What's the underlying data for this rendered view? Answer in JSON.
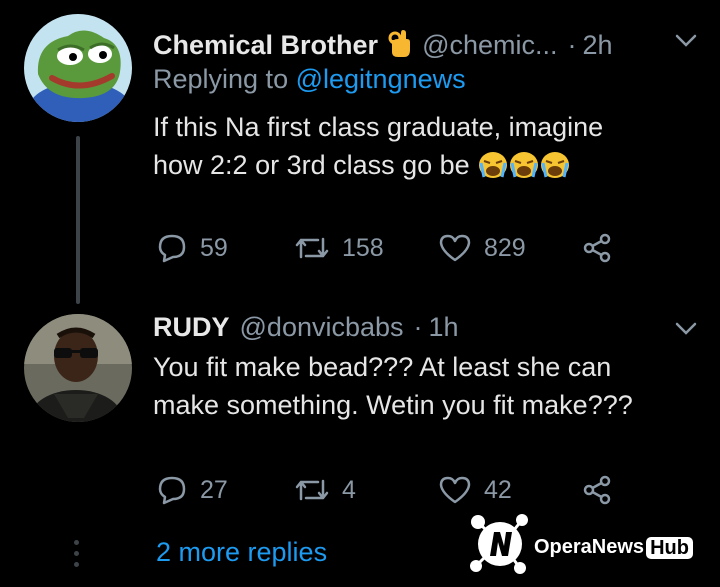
{
  "tweets": [
    {
      "name": "Chemical Brother",
      "name_emoji": "👌",
      "handle": "@chemic...",
      "dot": "·",
      "time": "2h",
      "replying_prefix": "Replying to",
      "replying_to": "@legitngnews",
      "body_lines": [
        "If this Na first class graduate, imagine",
        "how 2:2 or 3rd class go be"
      ],
      "replies": "59",
      "retweets": "158",
      "likes": "829"
    },
    {
      "name": "RUDY",
      "handle": "@donvicbabs",
      "dot": "·",
      "time": "1h",
      "body_lines": [
        "You fit make bead??? At least she can",
        "make something. Wetin you fit make???"
      ],
      "replies": "27",
      "retweets": "4",
      "likes": "42"
    }
  ],
  "more_replies": "2 more replies",
  "watermark": {
    "brand": "OperaNews",
    "hub": "Hub"
  },
  "colors": {
    "background": "#000000",
    "link": "#1d9bf0",
    "muted": "#8b98a5",
    "text": "#e6e6e6"
  }
}
